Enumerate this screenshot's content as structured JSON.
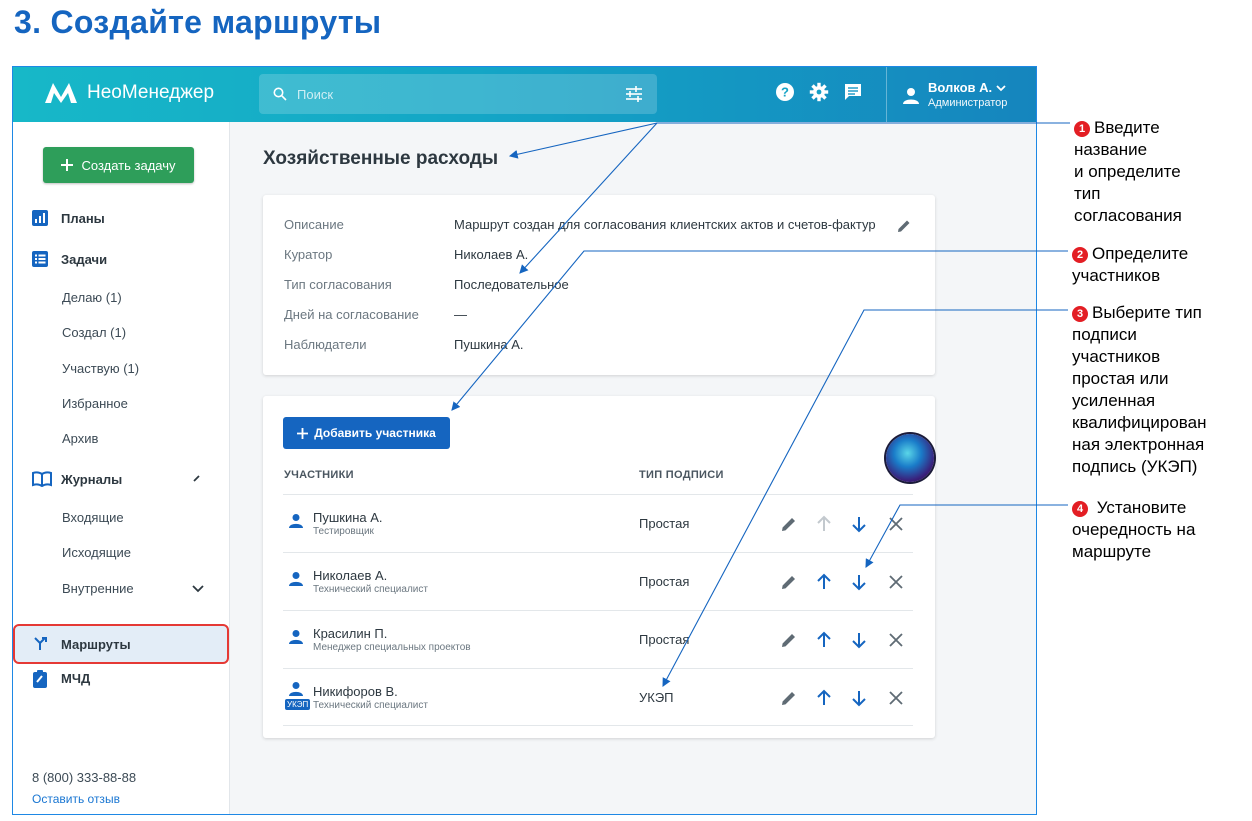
{
  "page_title": "3. Создайте маршруты",
  "app": {
    "name": "НеоМенеджер"
  },
  "search": {
    "placeholder": "Поиск"
  },
  "user": {
    "name": "Волков А.",
    "role": "Администратор"
  },
  "sidebar": {
    "create_button": "Создать задачу",
    "sections": [
      {
        "label": "Планы",
        "icon": "chart-icon"
      },
      {
        "label": "Задачи",
        "icon": "list-icon"
      },
      {
        "label": "Журналы",
        "icon": "book-icon"
      },
      {
        "label": "Маршруты",
        "icon": "route-icon"
      },
      {
        "label": "МЧД",
        "icon": "clipboard-icon"
      }
    ],
    "task_items": [
      "Делаю (1)",
      "Создал (1)",
      "Участвую (1)",
      "Избранное",
      "Архив"
    ],
    "journal_items": [
      "Входящие",
      "Исходящие",
      "Внутренние"
    ],
    "phone": "8 (800) 333-88-88",
    "feedback": "Оставить отзыв"
  },
  "route": {
    "title": "Хозяйственные расходы",
    "fields": [
      {
        "label": "Описание",
        "value": "Маршрут создан для согласования клиентских актов и счетов-фактур"
      },
      {
        "label": "Куратор",
        "value": "Николаев А."
      },
      {
        "label": "Тип согласования",
        "value": "Последовательное"
      },
      {
        "label": "Дней на согласование",
        "value": "—"
      },
      {
        "label": "Наблюдатели",
        "value": "Пушкина А."
      }
    ]
  },
  "participants": {
    "add_button": "Добавить участника",
    "col_participants": "УЧАСТНИКИ",
    "col_signature": "ТИП ПОДПИСИ",
    "ukep_badge": "УКЭП",
    "rows": [
      {
        "name": "Пушкина А.",
        "role": "Тестировщик",
        "signature": "Простая",
        "up_enabled": false
      },
      {
        "name": "Николаев А.",
        "role": "Технический специалист",
        "signature": "Простая",
        "up_enabled": true
      },
      {
        "name": "Красилин П.",
        "role": "Менеджер специальных проектов",
        "signature": "Простая",
        "up_enabled": true
      },
      {
        "name": "Никифоров В.",
        "role": "Технический специалист",
        "signature": "УКЭП",
        "up_enabled": true
      }
    ]
  },
  "annotations": [
    {
      "num": "1",
      "text": "Введите\nназвание\nи определите\nтип\nсогласования"
    },
    {
      "num": "2",
      "text": "Определите\nучастников"
    },
    {
      "num": "3",
      "text": "Выберите тип\nподписи\nучастников\nпростая или\nусиленная\nквалифицирован\nная электронная\nподпись (УКЭП)"
    },
    {
      "num": "4",
      "text": " Установите\nочередность на\nмаршруте"
    }
  ],
  "colors": {
    "brand_blue": "#1565c0",
    "create_green": "#2e9e5a",
    "highlight_red": "#e53935",
    "topbar": "#17b8c8"
  }
}
